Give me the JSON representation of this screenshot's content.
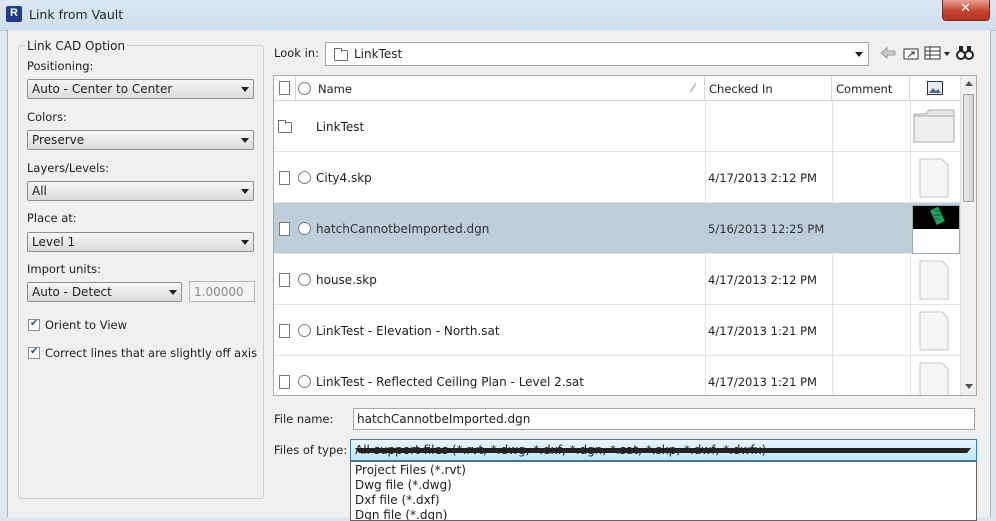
{
  "window": {
    "title": "Link from Vault",
    "close_glyph": "✕"
  },
  "options": {
    "group_title": "Link CAD Option",
    "positioning": {
      "label": "Positioning:",
      "value": "Auto - Center to Center"
    },
    "colors": {
      "label": "Colors:",
      "value": "Preserve"
    },
    "layers": {
      "label": "Layers/Levels:",
      "value": "All"
    },
    "place_at": {
      "label": "Place at:",
      "value": "Level 1"
    },
    "import_units": {
      "label": "Import units:",
      "value": "Auto - Detect",
      "scale": "1.00000"
    },
    "orient_to_view": {
      "label": "Orient to View",
      "checked": true
    },
    "correct_lines": {
      "label": "Correct lines that are slightly off axis",
      "checked": true
    }
  },
  "lookin": {
    "label": "Look in:",
    "value": "LinkTest"
  },
  "toolbar_icons": [
    "back-arrow-icon",
    "up-folder-icon",
    "view-menu-icon",
    "binoculars-icon"
  ],
  "list": {
    "columns": {
      "name": "Name",
      "checked_in": "Checked In",
      "comment": "Comment"
    },
    "rows": [
      {
        "name": "LinkTest",
        "checked_in": "",
        "comment": "",
        "type": "folder",
        "selected": false
      },
      {
        "name": "City4.skp",
        "checked_in": "4/17/2013 2:12 PM",
        "comment": "",
        "type": "file",
        "selected": false
      },
      {
        "name": "hatchCannotbeImported.dgn",
        "checked_in": "5/16/2013 12:25 PM",
        "comment": "",
        "type": "file",
        "selected": true
      },
      {
        "name": "house.skp",
        "checked_in": "4/17/2013 2:12 PM",
        "comment": "",
        "type": "file",
        "selected": false
      },
      {
        "name": "LinkTest - Elevation - North.sat",
        "checked_in": "4/17/2013 1:21 PM",
        "comment": "",
        "type": "file",
        "selected": false
      },
      {
        "name": "LinkTest - Reflected Ceiling Plan - Level 2.sat",
        "checked_in": "4/17/2013 1:21 PM",
        "comment": "",
        "type": "file",
        "selected": false
      }
    ]
  },
  "file_name": {
    "label": "File name:",
    "value": "hatchCannotbeImported.dgn"
  },
  "files_of_type": {
    "label": "Files of type:",
    "value": "All support files (*.rvt, *.dwg, *.dxf, *.dgn, *.sat, *.skp, *.dwf, *.dwfx)",
    "options": [
      "Project Files (*.rvt)",
      "Dwg file (*.dwg)",
      "Dxf file (*.dxf)",
      "Dgn file (*.dgn)"
    ]
  }
}
